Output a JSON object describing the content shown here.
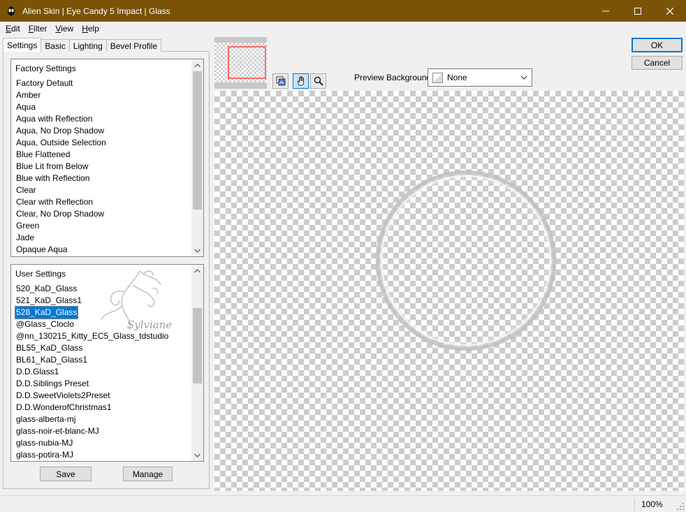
{
  "window": {
    "title": "Alien Skin | Eye Candy 5 Impact | Glass",
    "minimize": "—",
    "maximize": "☐",
    "close": "✕"
  },
  "menu": [
    {
      "label": "Edit",
      "key": "E",
      "rest": "dit"
    },
    {
      "label": "Filter",
      "key": "F",
      "rest": "ilter"
    },
    {
      "label": "View",
      "key": "V",
      "rest": "iew"
    },
    {
      "label": "Help",
      "key": "H",
      "rest": "elp"
    }
  ],
  "tabs": [
    "Settings",
    "Basic",
    "Lighting",
    "Bevel Profile"
  ],
  "factory_settings": {
    "header": "Factory Settings",
    "items": [
      "Factory Default",
      "Amber",
      "Aqua",
      "Aqua with Reflection",
      "Aqua, No Drop Shadow",
      "Aqua, Outside Selection",
      "Blue Flattened",
      "Blue Lit from Below",
      "Blue with Reflection",
      "Clear",
      "Clear with Reflection",
      "Clear, No Drop Shadow",
      "Green",
      "Jade",
      "Opaque Aqua"
    ]
  },
  "user_settings": {
    "header": "User Settings",
    "selected": "528_KaD_Glass",
    "items": [
      "520_KaD_Glass",
      "521_KaD_Glass1",
      "528_KaD_Glass",
      "@Glass_Cloclo",
      "@nn_130215_Kitty_EC5_Glass_tdstudio",
      "BL55_KaD_Glass",
      "BL61_KaD_Glass1",
      "D.D.Glass1",
      "D.D.Siblings Preset",
      "D.D.SweetViolets2Preset",
      "D.D.WonderofChristmas1",
      "glass-alberta-mj",
      "glass-noir-et-blanc-MJ",
      "glass-nubia-MJ",
      "glass-potira-MJ"
    ]
  },
  "watermark_text": "Sylviane",
  "buttons": {
    "save": "Save",
    "manage": "Manage",
    "ok": "OK",
    "cancel": "Cancel"
  },
  "preview_background": {
    "label": "Preview Background:",
    "value": "None"
  },
  "status": {
    "zoom": "100%"
  },
  "colors": {
    "titlebar": "#7a5306",
    "selection": "#0078d7",
    "nav_rect": "#ff6a6a"
  }
}
